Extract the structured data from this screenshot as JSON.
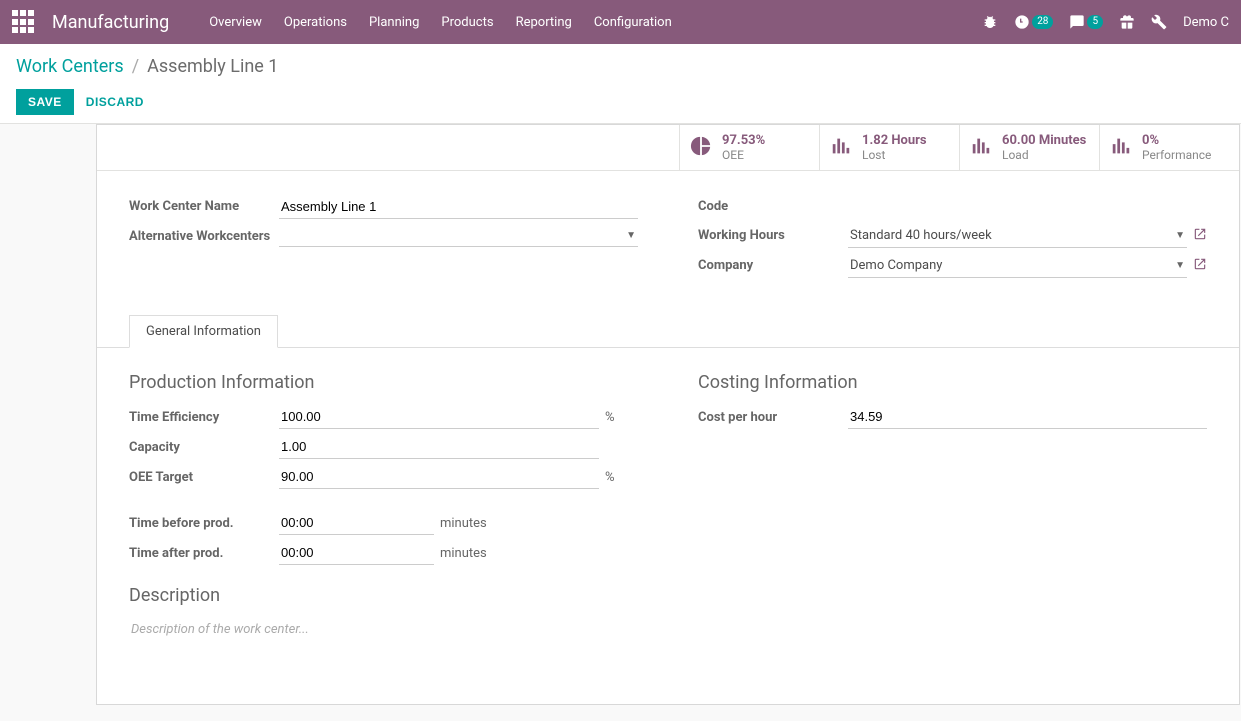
{
  "navbar": {
    "brand": "Manufacturing",
    "menu": [
      "Overview",
      "Operations",
      "Planning",
      "Products",
      "Reporting",
      "Configuration"
    ],
    "badge_clock": "28",
    "badge_msg": "5",
    "user": "Demo C"
  },
  "breadcrumb": {
    "parent": "Work Centers",
    "current": "Assembly Line 1"
  },
  "buttons": {
    "save": "SAVE",
    "discard": "DISCARD"
  },
  "stats": {
    "oee": {
      "val": "97.53%",
      "lbl": "OEE"
    },
    "lost": {
      "val": "1.82 Hours",
      "lbl": "Lost"
    },
    "load": {
      "val": "60.00 Minutes",
      "lbl": "Load"
    },
    "perf": {
      "val": "0%",
      "lbl": "Performance"
    }
  },
  "fields": {
    "name_label": "Work Center Name",
    "name_value": "Assembly Line 1",
    "alt_label": "Alternative Workcenters",
    "alt_value": "",
    "code_label": "Code",
    "code_value": "",
    "hours_label": "Working Hours",
    "hours_value": "Standard 40 hours/week",
    "company_label": "Company",
    "company_value": "Demo Company"
  },
  "tabs": {
    "general": "General Information"
  },
  "production": {
    "title": "Production Information",
    "eff_label": "Time Efficiency",
    "eff_value": "100.00",
    "eff_suffix": "%",
    "cap_label": "Capacity",
    "cap_value": "1.00",
    "oee_label": "OEE Target",
    "oee_value": "90.00",
    "oee_suffix": "%",
    "before_label": "Time before prod.",
    "before_value": "00:00",
    "before_suffix": "minutes",
    "after_label": "Time after prod.",
    "after_value": "00:00",
    "after_suffix": "minutes"
  },
  "costing": {
    "title": "Costing Information",
    "cost_label": "Cost per hour",
    "cost_value": "34.59"
  },
  "description": {
    "title": "Description",
    "placeholder": "Description of the work center..."
  }
}
